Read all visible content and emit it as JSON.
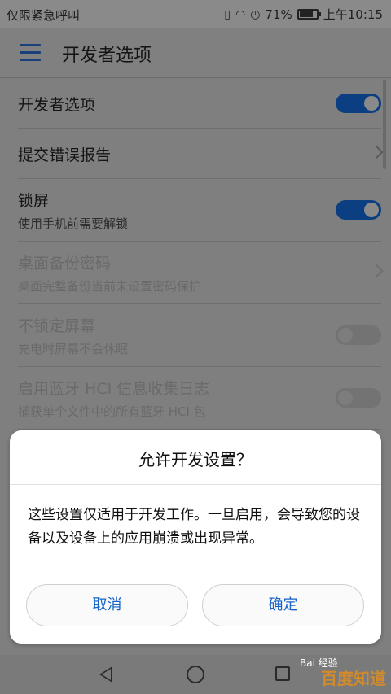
{
  "status_bar": {
    "carrier": "仅限紧急呼叫",
    "battery_pct": "71%",
    "time": "上午10:15",
    "icons": [
      "vibrate-icon",
      "wifi-icon",
      "alarm-icon",
      "battery-icon"
    ]
  },
  "app_bar": {
    "title": "开发者选项",
    "menu_icon": "menu-icon"
  },
  "settings": [
    {
      "title": "开发者选项",
      "control": "toggle",
      "on": true,
      "enabled": true
    },
    {
      "title": "提交错误报告",
      "control": "chevron",
      "enabled": true
    },
    {
      "title": "锁屏",
      "subtitle": "使用手机前需要解锁",
      "control": "toggle",
      "on": true,
      "enabled": true
    },
    {
      "title": "桌面备份密码",
      "subtitle": "桌面完整备份当前未设置密码保护",
      "control": "chevron",
      "enabled": false
    },
    {
      "title": "不锁定屏幕",
      "subtitle": "充电时屏幕不会休眠",
      "control": "toggle",
      "on": false,
      "enabled": false
    },
    {
      "title": "启用蓝牙 HCI 信息收集日志",
      "subtitle": "捕获单个文件中的所有蓝牙 HCI 包",
      "control": "toggle",
      "on": false,
      "enabled": false
    }
  ],
  "dialog": {
    "title": "允许开发设置？",
    "message": "这些设置仅适用于开发工作。一旦启用，会导致您的设备以及设备上的应用崩溃或出现异常。",
    "cancel_label": "取消",
    "ok_label": "确定",
    "accent_color": "#1764c6"
  },
  "nav_bar": {
    "icons": [
      "back-icon",
      "home-icon",
      "recent-apps-icon"
    ]
  },
  "watermark": {
    "text": "百度知道",
    "small": "Bai 经验"
  },
  "colors": {
    "toggle_on": "#0c3f82",
    "dim_background": "#7f7f7f"
  }
}
